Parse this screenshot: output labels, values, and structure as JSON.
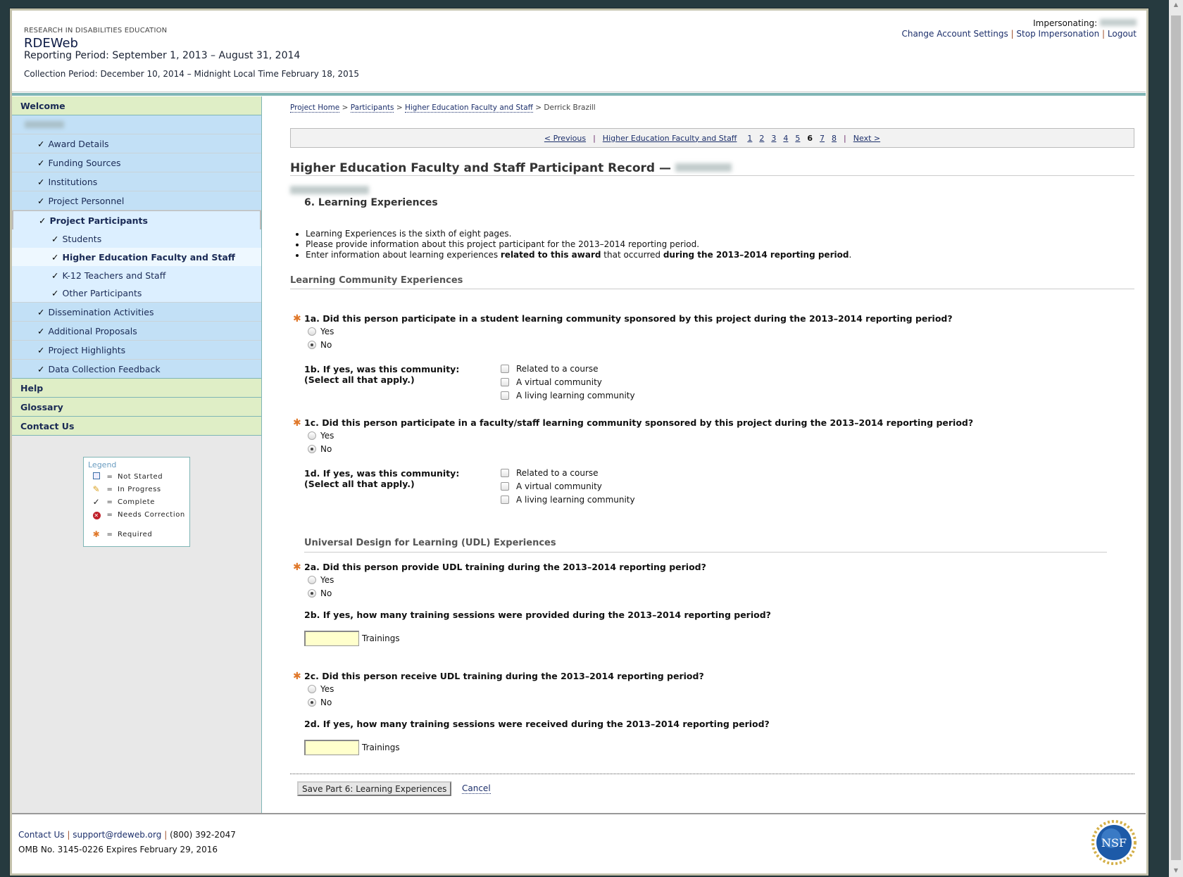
{
  "header": {
    "org": "RESEARCH IN DISABILITIES EDUCATION",
    "app_title": "RDEWeb",
    "reporting_period": "Reporting Period: September 1, 2013 – August 31, 2014",
    "collection_period": "Collection Period: December 10, 2014 – Midnight Local Time February 18, 2015",
    "impersonating_label": "Impersonating:",
    "links": [
      "Change Account Settings",
      "Stop Impersonation",
      "Logout"
    ],
    "link_separator": "|"
  },
  "sidebar": {
    "welcome": "Welcome",
    "items": [
      {
        "label": "Award Details",
        "status": "complete"
      },
      {
        "label": "Funding Sources",
        "status": "complete"
      },
      {
        "label": "Institutions",
        "status": "complete"
      },
      {
        "label": "Project Personnel",
        "status": "complete"
      },
      {
        "label": "Project Participants",
        "status": "complete"
      },
      {
        "label": "Students",
        "status": "complete"
      },
      {
        "label": "Higher Education Faculty and Staff",
        "status": "complete"
      },
      {
        "label": "K-12 Teachers and Staff",
        "status": "complete"
      },
      {
        "label": "Other Participants",
        "status": "complete"
      },
      {
        "label": "Dissemination Activities",
        "status": "complete"
      },
      {
        "label": "Additional Proposals",
        "status": "complete"
      },
      {
        "label": "Project Highlights",
        "status": "complete"
      },
      {
        "label": "Data Collection Feedback",
        "status": "complete"
      }
    ],
    "check": "✓",
    "help": "Help",
    "glossary": "Glossary",
    "contact": "Contact Us"
  },
  "legend": {
    "title": "Legend",
    "eq": "=",
    "items": [
      "Not Started",
      "In Progress",
      "Complete",
      "Needs Correction",
      "Required"
    ]
  },
  "breadcrumb": {
    "items": [
      "Project Home",
      "Participants",
      "Higher Education Faculty and Staff"
    ],
    "current": "Derrick Brazill",
    "sep": ">"
  },
  "pager": {
    "prev": "< Previous",
    "section": "Higher Education Faculty and Staff",
    "pages": [
      "1",
      "2",
      "3",
      "4",
      "5",
      "6",
      "7",
      "8"
    ],
    "current_page": "6",
    "next": "Next >",
    "sep": "|"
  },
  "page": {
    "title": "Higher Education Faculty and Staff Participant Record —",
    "subtitle": "6. Learning Experiences",
    "bullets": {
      "b1": "Learning Experiences is the sixth of eight pages.",
      "b2": "Please provide information about this project participant for the 2013–2014 reporting period.",
      "b3_a": "Enter information about learning experiences ",
      "b3_b": "related to this award",
      "b3_c": " that occurred ",
      "b3_d": "during the 2013–2014 reporting period",
      "b3_e": "."
    }
  },
  "form": {
    "required_mark": "✱",
    "section1": "Learning Community Experiences",
    "q1a": "1a. Did this person participate in a student learning community sponsored by this project during the 2013–2014 reporting period?",
    "q1b": "1b. If yes, was this community:",
    "q1b_note": "(Select all that apply.)",
    "q1c": "1c. Did this person participate in a faculty/staff learning community sponsored by this project during the 2013–2014 reporting period?",
    "q1d": "1d. If yes, was this community:",
    "q1d_note": "(Select all that apply.)",
    "yes": "Yes",
    "no": "No",
    "community_options": [
      "Related to a course",
      "A virtual community",
      "A living learning community"
    ],
    "section2": "Universal Design for Learning (UDL) Experiences",
    "q2a": "2a. Did this person provide UDL training during the 2013–2014 reporting period?",
    "q2b": "2b. If yes, how many training sessions were provided during the 2013–2014 reporting period?",
    "q2c": "2c. Did this person receive UDL training during the 2013–2014 reporting period?",
    "q2d": "2d. If yes, how many training sessions were received during the 2013–2014 reporting period?",
    "trainings_unit": "Trainings",
    "q2b_value": "",
    "q2d_value": "",
    "answers": {
      "q1a": "No",
      "q1c": "No",
      "q2a": "No",
      "q2c": "No"
    },
    "save": "Save Part 6: Learning Experiences",
    "cancel": "Cancel"
  },
  "footer": {
    "contact": "Contact Us",
    "email": "support@rdeweb.org",
    "phone": "(800) 392-2047",
    "sep": "|",
    "omb": "OMB No. 3145-0226 Expires February 29, 2016",
    "logo_text": "NSF"
  },
  "colors": {
    "nav_green": "#dfeec6",
    "nav_blue": "#c2e0f6",
    "teal": "#7fb5b5",
    "required": "#e0782a",
    "input_bg": "#ffffcc"
  }
}
